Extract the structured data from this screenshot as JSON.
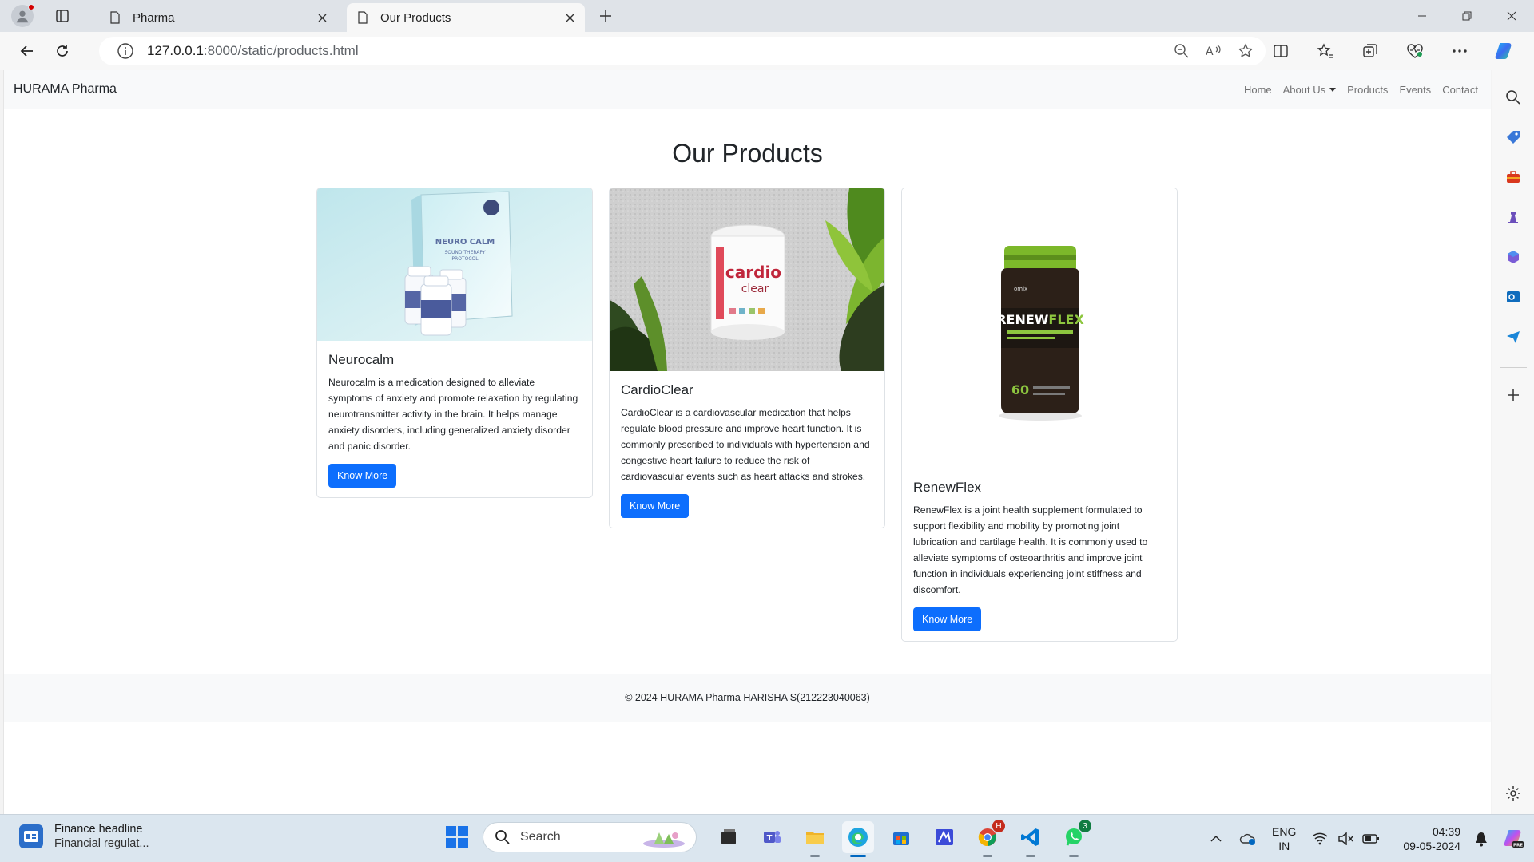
{
  "browser": {
    "tabs": [
      {
        "title": "Pharma",
        "active": false
      },
      {
        "title": "Our Products",
        "active": true
      }
    ],
    "address": {
      "host": "127.0.0.1",
      "path": ":8000/static/products.html"
    }
  },
  "site": {
    "brand": "HURAMA Pharma",
    "nav": {
      "home": "Home",
      "about": "About Us",
      "products": "Products",
      "events": "Events",
      "contact": "Contact"
    },
    "page_title": "Our Products",
    "products": [
      {
        "name": "Neurocalm",
        "description": "Neurocalm is a medication designed to alleviate symptoms of anxiety and promote relaxation by regulating neurotransmitter activity in the brain. It helps manage anxiety disorders, including generalized anxiety disorder and panic disorder.",
        "button": "Know More",
        "image_label": "NEURO CALM SOUND THERAPY PROTOCOL"
      },
      {
        "name": "CardioClear",
        "description": "CardioClear is a cardiovascular medication that helps regulate blood pressure and improve heart function. It is commonly prescribed to individuals with hypertension and congestive heart failure to reduce the risk of cardiovascular events such as heart attacks and strokes.",
        "button": "Know More",
        "image_label": "cardio clear"
      },
      {
        "name": "RenewFlex",
        "description": "RenewFlex is a joint health supplement formulated to support flexibility and mobility by promoting joint lubrication and cartilage health. It is commonly used to alleviate symptoms of osteoarthritis and improve joint function in individuals experiencing joint stiffness and discomfort.",
        "button": "Know More",
        "image_label": "RENEWFLEX"
      }
    ],
    "footer": "© 2024 HURAMA Pharma HARISHA S(212223040063)"
  },
  "taskbar": {
    "news_title": "Finance headline",
    "news_sub": "Financial regulat...",
    "search_placeholder": "Search",
    "lang_top": "ENG",
    "lang_bottom": "IN",
    "time": "04:39",
    "date": "09-05-2024",
    "badges": {
      "chrome": "H",
      "whatsapp": "3"
    }
  },
  "colors": {
    "primary_button": "#0d6efd",
    "navbar_bg": "#f8f9fa",
    "accent": "#0067c0"
  }
}
